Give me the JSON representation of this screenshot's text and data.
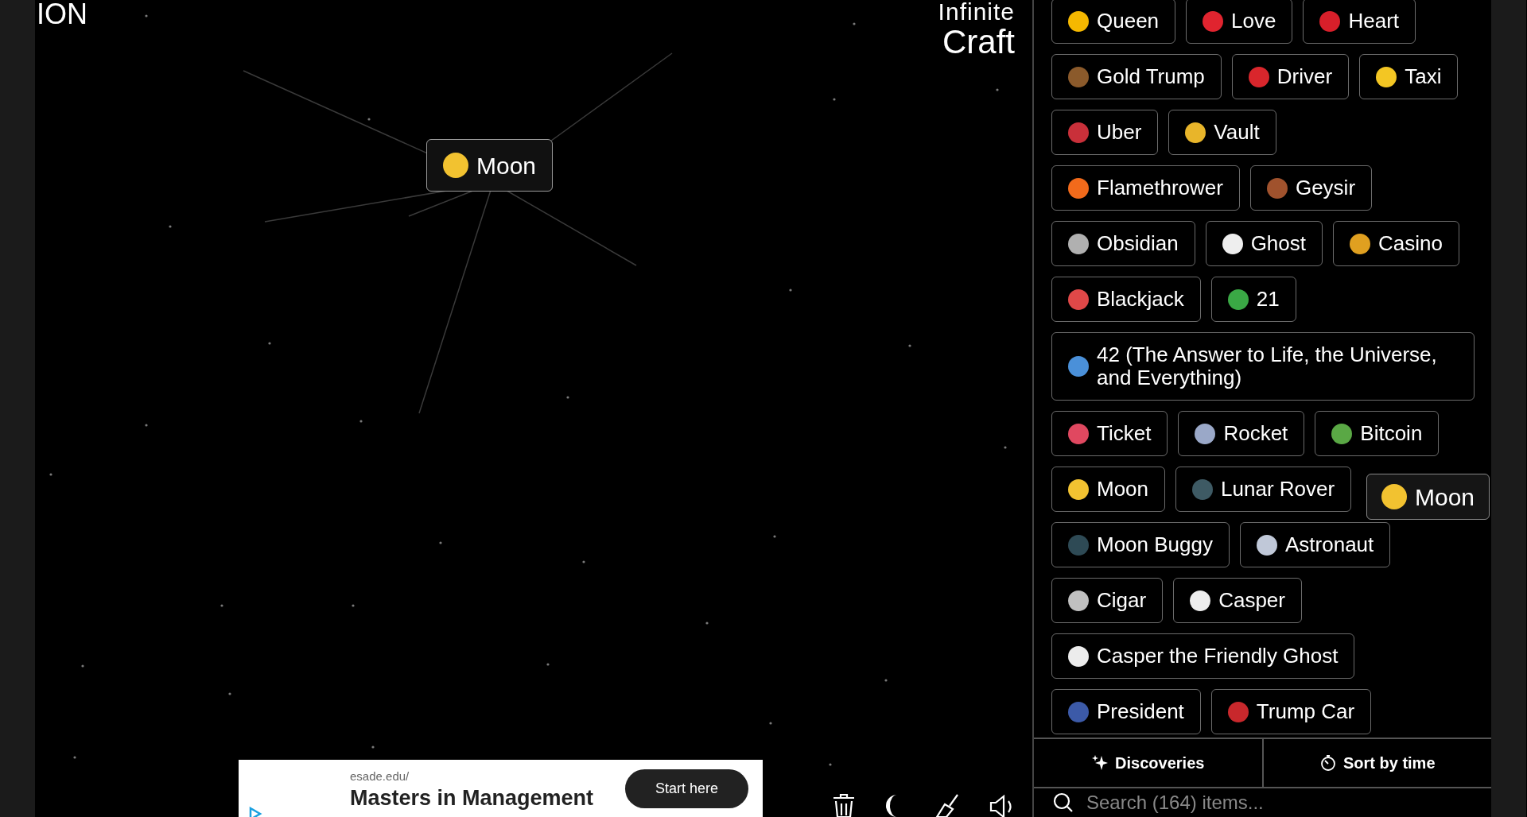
{
  "corner_text": "ION",
  "logo": {
    "line_1": "Infinite",
    "line_2": "Craft"
  },
  "canvas": {
    "elements": [
      {
        "label": "Moon",
        "color": "#f2c230"
      }
    ]
  },
  "dragged_element": {
    "label": "Moon",
    "color": "#f2c230"
  },
  "ad": {
    "url": "esade.edu/",
    "headline": "Masters in Management",
    "button": "Start here"
  },
  "sidebar": {
    "items": [
      {
        "label": "Queen",
        "color": "#f5b800"
      },
      {
        "label": "Love",
        "color": "#e0242f"
      },
      {
        "label": "Heart",
        "color": "#d81f2a"
      },
      {
        "label": "Gold Trump",
        "color": "#8b5a2b"
      },
      {
        "label": "Driver",
        "color": "#d9262c"
      },
      {
        "label": "Taxi",
        "color": "#f3c623"
      },
      {
        "label": "Uber",
        "color": "#c9303a"
      },
      {
        "label": "Vault",
        "color": "#e8b52a"
      },
      {
        "label": "Flamethrower",
        "color": "#f26a1b"
      },
      {
        "label": "Geysir",
        "color": "#a0522d"
      },
      {
        "label": "Obsidian",
        "color": "#b0b0b0"
      },
      {
        "label": "Ghost",
        "color": "#eeeeee"
      },
      {
        "label": "Casino",
        "color": "#e0a020"
      },
      {
        "label": "Blackjack",
        "color": "#e04848"
      },
      {
        "label": "21",
        "color": "#3aa845"
      },
      {
        "label": "42 (The Answer to Life, the Universe, and Everything)",
        "color": "#4a90d9"
      },
      {
        "label": "Ticket",
        "color": "#e04860"
      },
      {
        "label": "Rocket",
        "color": "#9aa8c8"
      },
      {
        "label": "Bitcoin",
        "color": "#5aa845"
      },
      {
        "label": "Moon",
        "color": "#f2c231"
      },
      {
        "label": "Lunar Rover",
        "color": "#3e5a64"
      },
      {
        "label": "Moon Buggy",
        "color": "#2e4a55"
      },
      {
        "label": "Astronaut",
        "color": "#c0c8d8"
      },
      {
        "label": "Cigar",
        "color": "#c0c0c0"
      },
      {
        "label": "Casper",
        "color": "#ededed"
      },
      {
        "label": "Casper the Friendly Ghost",
        "color": "#ececec"
      },
      {
        "label": "President",
        "color": "#3c5aa8"
      },
      {
        "label": "Trump Car",
        "color": "#c8282c"
      }
    ],
    "tabs": [
      "Discoveries",
      "Sort by time"
    ],
    "search": {
      "placeholder": "Search (164) items..."
    }
  }
}
